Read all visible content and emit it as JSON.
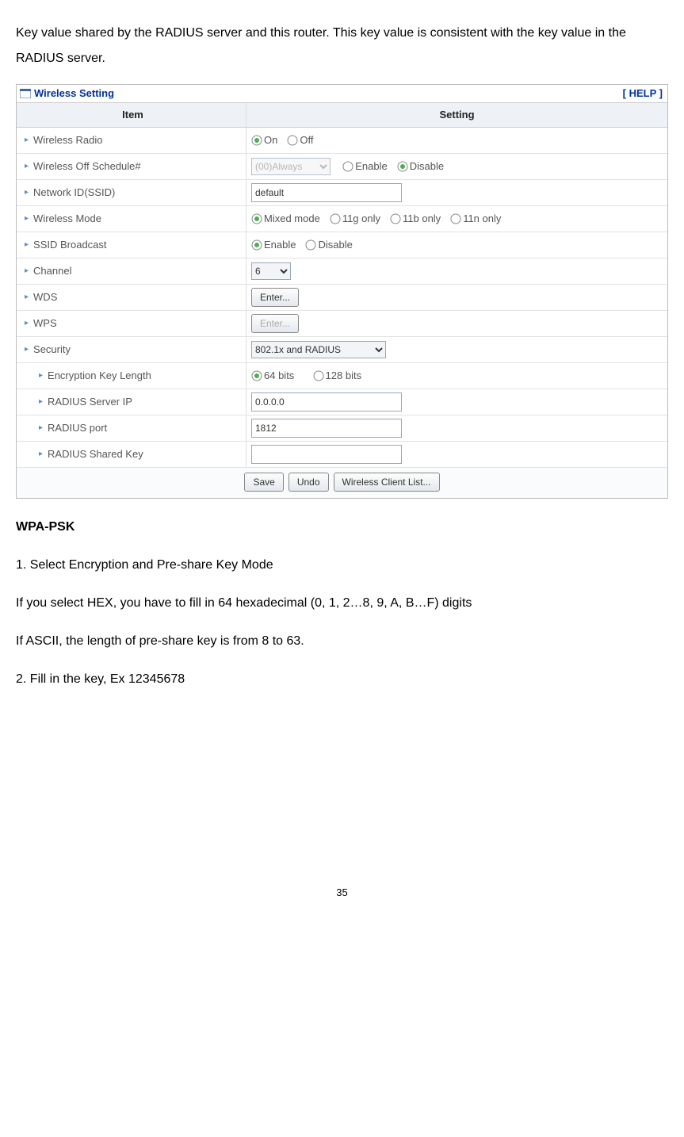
{
  "intro": "Key value shared by the RADIUS server and this router. This key value is consistent with the key value in the RADIUS server.",
  "panel": {
    "title": "Wireless Setting",
    "help": "[ HELP ]",
    "header_item": "Item",
    "header_setting": "Setting",
    "rows": {
      "wireless_radio": {
        "label": "Wireless Radio",
        "on": "On",
        "off": "Off",
        "value": "on"
      },
      "off_schedule": {
        "label": "Wireless Off Schedule#",
        "dropdown": "(00)Always",
        "enable": "Enable",
        "disable": "Disable",
        "value": "disable"
      },
      "ssid": {
        "label": "Network ID(SSID)",
        "value": "default"
      },
      "mode": {
        "label": "Wireless Mode",
        "mixed": "Mixed mode",
        "g": "11g only",
        "b": "11b only",
        "n": "11n only",
        "value": "mixed"
      },
      "broadcast": {
        "label": "SSID Broadcast",
        "enable": "Enable",
        "disable": "Disable",
        "value": "enable"
      },
      "channel": {
        "label": "Channel",
        "value": "6"
      },
      "wds": {
        "label": "WDS",
        "button": "Enter..."
      },
      "wps": {
        "label": "WPS",
        "button": "Enter..."
      },
      "security": {
        "label": "Security",
        "value": "802.1x and RADIUS"
      },
      "enc_len": {
        "label": "Encryption Key Length",
        "b64": "64 bits",
        "b128": "128 bits",
        "value": "64"
      },
      "radius_ip": {
        "label": "RADIUS Server IP",
        "value": "0.0.0.0"
      },
      "radius_port": {
        "label": "RADIUS port",
        "value": "1812"
      },
      "radius_key": {
        "label": "RADIUS Shared Key",
        "value": ""
      }
    },
    "actions": {
      "save": "Save",
      "undo": "Undo",
      "client_list": "Wireless Client List..."
    }
  },
  "wpa": {
    "heading": "WPA-PSK",
    "p1": "1. Select Encryption and Pre-share Key Mode",
    "p2": "If you select HEX, you have to fill in 64 hexadecimal (0, 1, 2…8, 9, A, B…F) digits",
    "p3": "If ASCII, the length of pre-share key is from 8 to 63.",
    "p4": "2. Fill in the key, Ex 12345678"
  },
  "page_number": "35"
}
